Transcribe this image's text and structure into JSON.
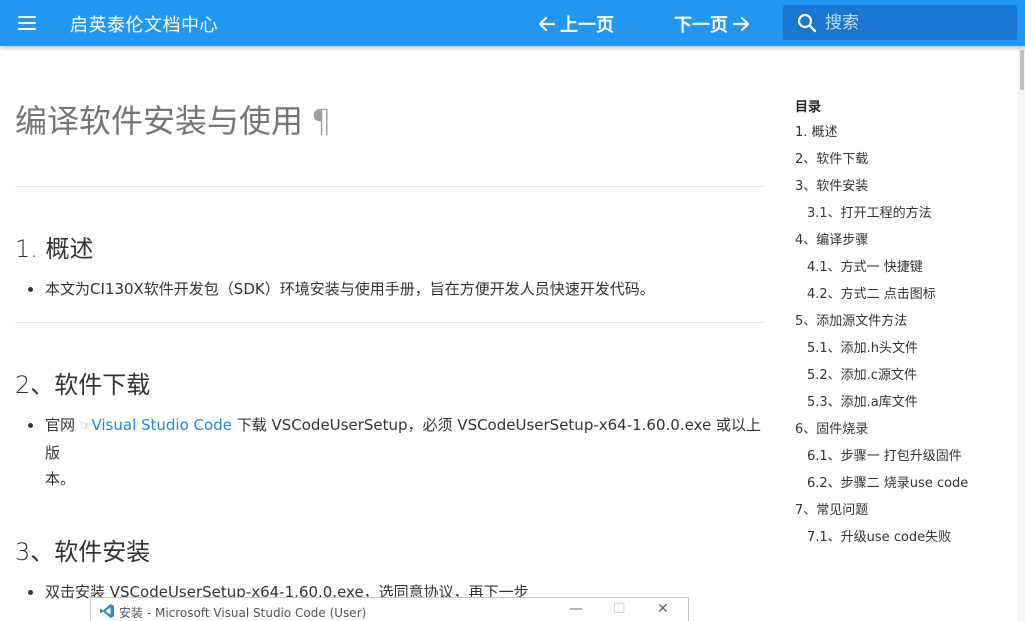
{
  "header": {
    "site_title": "启英泰伦文档中心",
    "prev_label": "上一页",
    "next_label": "下一页",
    "search_placeholder": "搜索"
  },
  "page": {
    "title": "编译软件安装与使用",
    "pilcrow": "¶"
  },
  "sections": [
    {
      "heading": "1. 概述",
      "text": "本文为CI130X软件开发包（SDK）环境安装与使用手册，旨在方便开发人员快速开发代码。"
    },
    {
      "heading": "2、软件下载",
      "text_before": "官网",
      "link_icon": "☞",
      "link_text": "Visual Studio Code",
      "text_after_line1": "下载 VSCodeUserSetup，必须 VSCodeUserSetup-x64-1.60.0.exe 或以上版",
      "text_after_line2": "本。"
    },
    {
      "heading": "3、软件安装",
      "text": "双击安装 VSCodeUserSetup-x64-1.60.0.exe，选同意协议，再下一步"
    }
  ],
  "installer_window": {
    "title": "安装 - Microsoft Visual Studio Code (User)"
  },
  "toc": {
    "heading": "目录",
    "items": [
      {
        "label": "1. 概述",
        "level": 1
      },
      {
        "label": "2、软件下载",
        "level": 1
      },
      {
        "label": "3、软件安装",
        "level": 1
      },
      {
        "label": "3.1、打开工程的方法",
        "level": 2
      },
      {
        "label": "4、编译步骤",
        "level": 1
      },
      {
        "label": "4.1、方式一 快捷键",
        "level": 2
      },
      {
        "label": "4.2、方式二 点击图标",
        "level": 2
      },
      {
        "label": "5、添加源文件方法",
        "level": 1
      },
      {
        "label": "5.1、添加.h头文件",
        "level": 2
      },
      {
        "label": "5.2、添加.c源文件",
        "level": 2
      },
      {
        "label": "5.3、添加.a库文件",
        "level": 2
      },
      {
        "label": "6、固件烧录",
        "level": 1
      },
      {
        "label": "6.1、步骤一 打包升级固件",
        "level": 2
      },
      {
        "label": "6.2、步骤二 烧录use code",
        "level": 2
      },
      {
        "label": "7、常见问题",
        "level": 1
      },
      {
        "label": "7.1、升级use code失败",
        "level": 2
      }
    ]
  },
  "colors": {
    "header_bg": "#2196f3",
    "search_bg": "#1976d2",
    "link": "#1e88e5"
  }
}
